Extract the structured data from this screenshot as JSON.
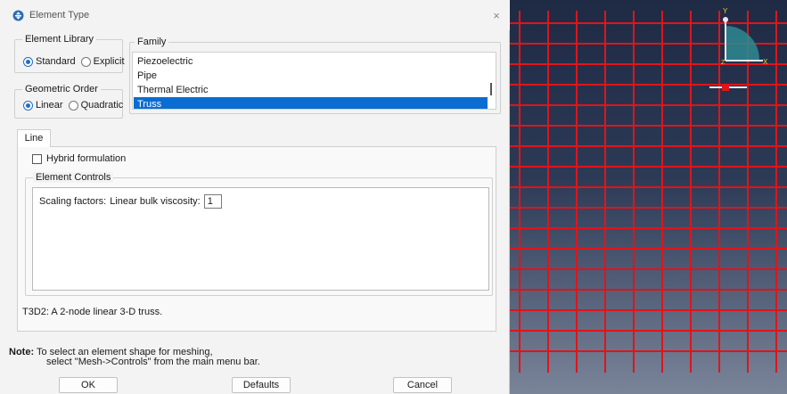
{
  "dialog": {
    "title": "Element Type",
    "close_glyph": "×",
    "title_icon": "abaqus-logo-icon"
  },
  "element_library": {
    "label": "Element Library",
    "options": [
      "Standard",
      "Explicit"
    ],
    "selected": "Standard"
  },
  "geometric_order": {
    "label": "Geometric Order",
    "options": [
      "Linear",
      "Quadratic"
    ],
    "selected": "Linear"
  },
  "family": {
    "label": "Family",
    "items": [
      "Piezoelectric",
      "Pipe",
      "Thermal Electric",
      "Truss"
    ],
    "selected": "Truss"
  },
  "tab": {
    "label": "Line"
  },
  "hybrid": {
    "label": "Hybrid formulation",
    "checked": false
  },
  "element_controls": {
    "label": "Element Controls",
    "scaling_label": "Scaling factors:",
    "viscosity_label": "Linear bulk viscosity:",
    "viscosity_value": "1"
  },
  "description": "T3D2:  A 2-node linear 3-D truss.",
  "note": {
    "label": "Note:",
    "line1": "To select an element shape for meshing,",
    "line2": "select \"Mesh->Controls\" from the main menu bar."
  },
  "buttons": {
    "ok": "OK",
    "defaults": "Defaults",
    "cancel": "Cancel"
  },
  "viewport": {
    "grid_color": "#e0141a",
    "background_top": "#1f2a44",
    "background_bottom": "#7a8499",
    "triad": {
      "y_label": "Y",
      "x_label": "X",
      "z_label": "Z"
    }
  }
}
